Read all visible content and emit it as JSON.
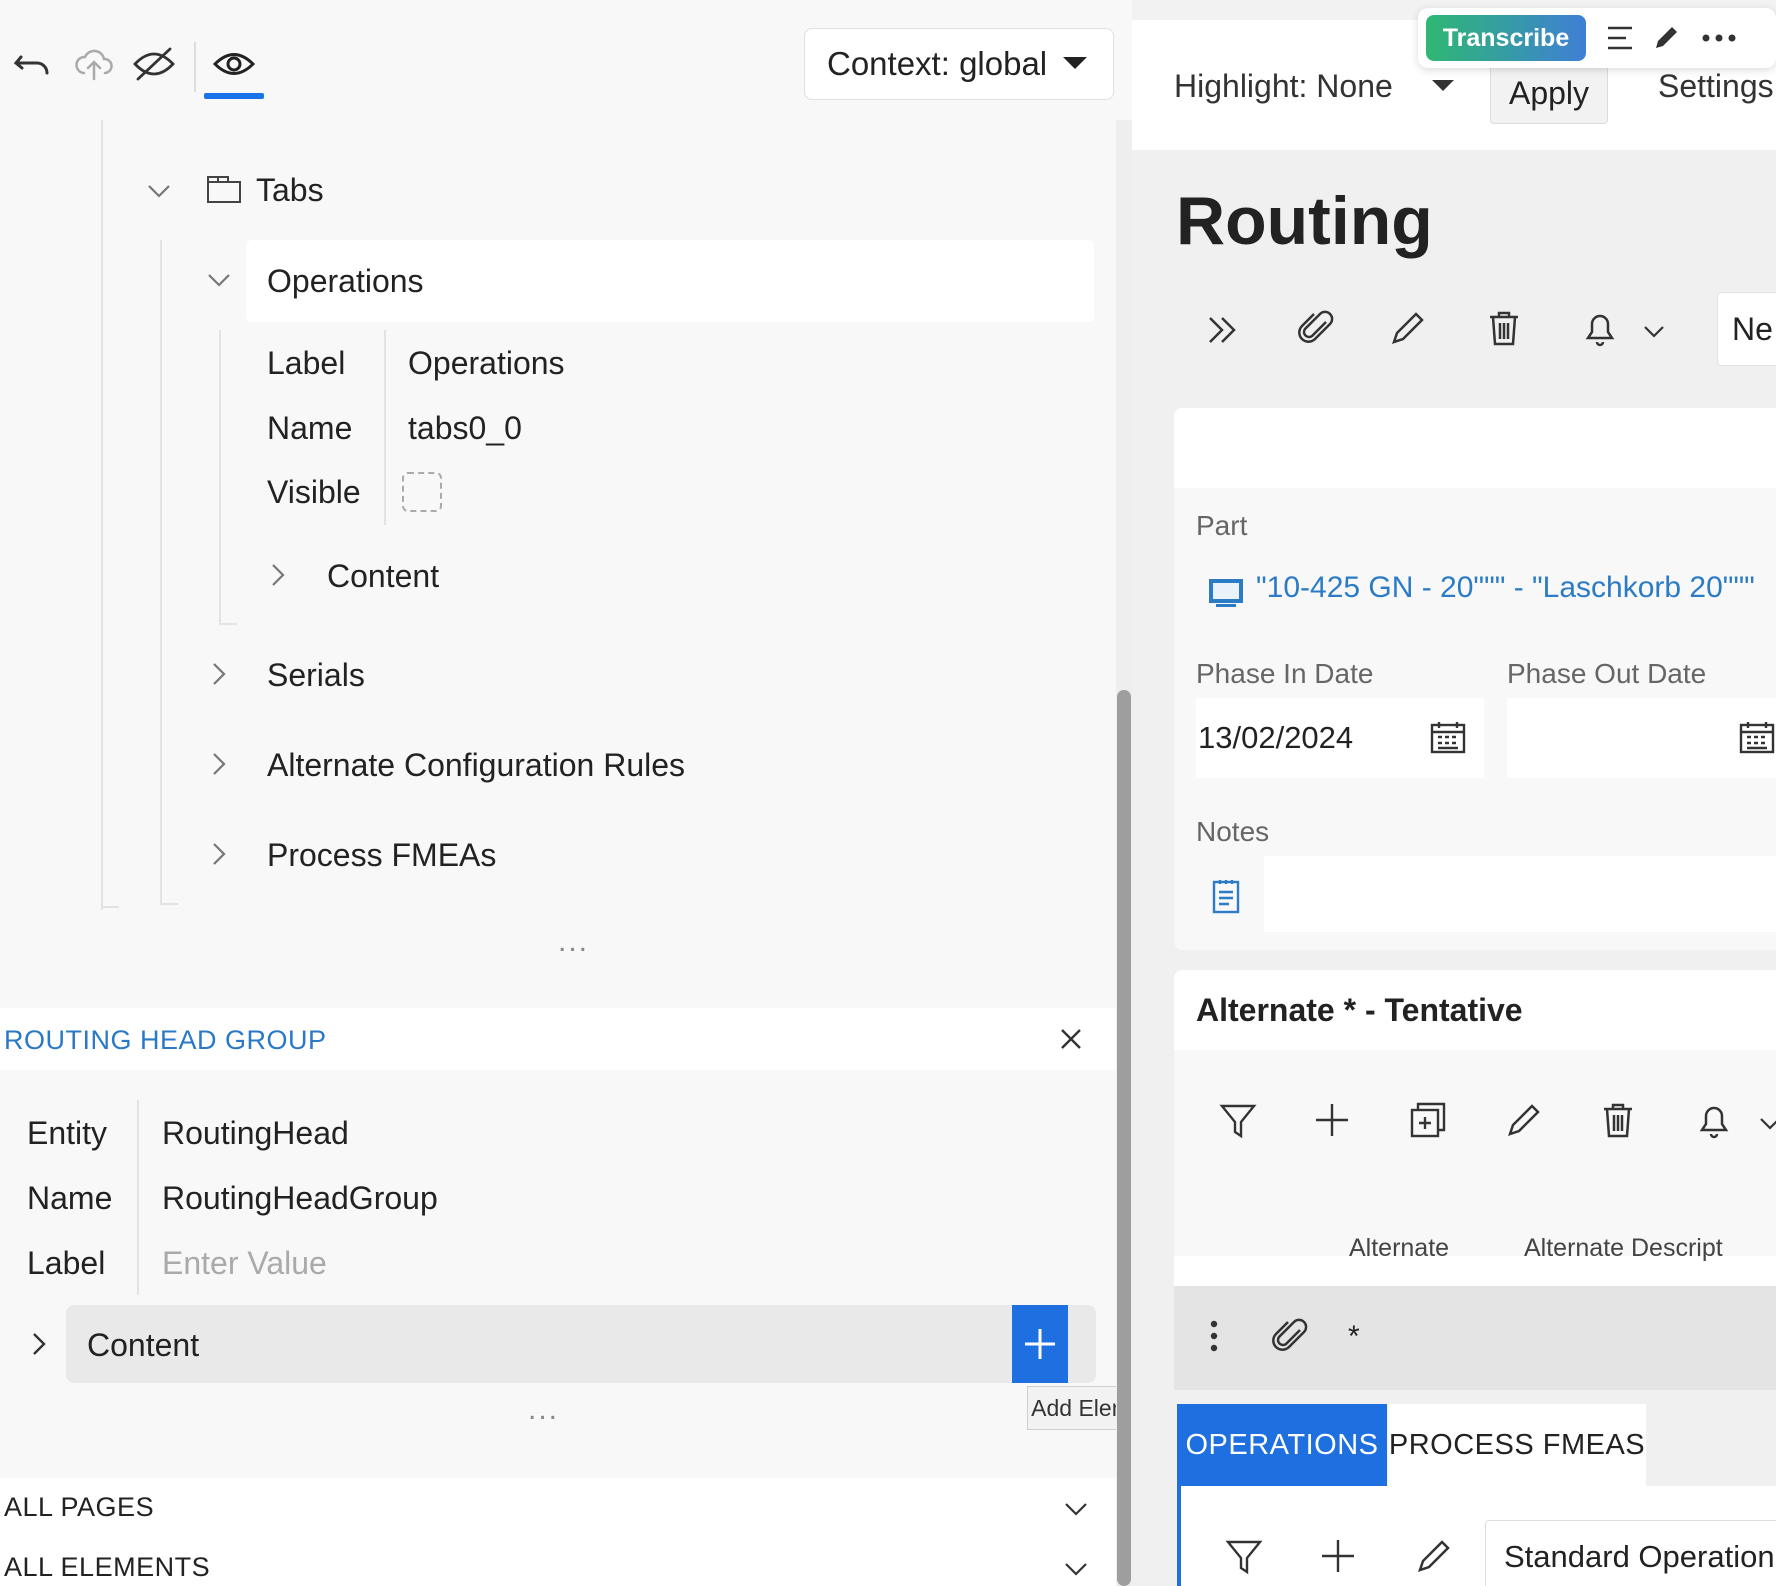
{
  "designer": {
    "context_label": "Context: global",
    "tree": {
      "tabs_label": "Tabs",
      "operations_label": "Operations",
      "props": {
        "label_key": "Label",
        "label_val": "Operations",
        "name_key": "Name",
        "name_val": "tabs0_0",
        "visible_key": "Visible"
      },
      "content_label": "Content",
      "serials_label": "Serials",
      "alt_config_label": "Alternate Configuration Rules",
      "fmea_label": "Process FMEAs",
      "more": "..."
    },
    "group": {
      "title": "ROUTING HEAD GROUP",
      "entity_key": "Entity",
      "entity_val": "RoutingHead",
      "name_key": "Name",
      "name_val": "RoutingHeadGroup",
      "label_key": "Label",
      "label_placeholder": "Enter Value",
      "content_label": "Content",
      "add_tooltip": "Add Element",
      "more": "..."
    },
    "footer": {
      "all_pages": "ALL PAGES",
      "all_elements": "ALL ELEMENTS"
    }
  },
  "preview": {
    "transcribe": "Transcribe",
    "highlight": "Highlight: None",
    "apply": "Apply",
    "settings": "Settings",
    "title": "Routing",
    "new_partial": "Ne",
    "part_label": "Part",
    "part_value": "\"10-425 GN - 20\"\"\" - \"Laschkorb 20\"\"\"",
    "phase_in_label": "Phase In Date",
    "phase_in_value": "13/02/2024",
    "phase_out_label": "Phase Out Date",
    "notes_label": "Notes",
    "alt_title": "Alternate * - Tentative",
    "col_alternate": "Alternate",
    "col_alt_desc": "Alternate Descript",
    "row_star": "*",
    "tab_operations": "OPERATIONS",
    "tab_fmeas": "PROCESS FMEAS",
    "std_op_partial": "Standard Operation"
  }
}
